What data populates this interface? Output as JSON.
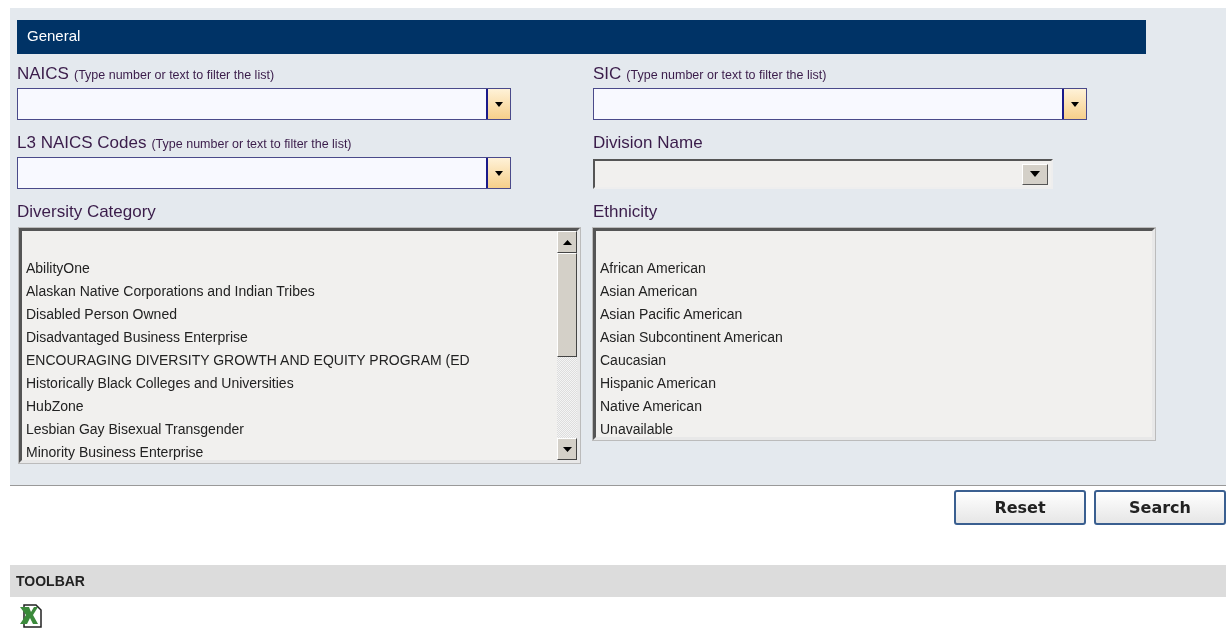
{
  "section": {
    "title": "General"
  },
  "fields": [
    {
      "kind": "combo",
      "label": "NAICS",
      "hint": "(Type number or text to filter the list)"
    },
    {
      "kind": "combo",
      "label": "SIC",
      "hint": "(Type number or text to filter the list)"
    },
    {
      "kind": "combo",
      "label": "L3 NAICS Codes",
      "hint": "(Type number or text to filter the list)"
    },
    {
      "kind": "select",
      "label": "Division Name"
    },
    {
      "kind": "list",
      "label": "Diversity Category",
      "scrollable": true,
      "items": [
        "AbilityOne",
        "Alaskan Native Corporations and Indian Tribes",
        "Disabled Person Owned",
        "Disadvantaged Business Enterprise",
        "ENCOURAGING DIVERSITY GROWTH AND EQUITY PROGRAM (ED",
        "Historically Black Colleges and Universities",
        "HubZone",
        "Lesbian Gay Bisexual Transgender",
        "Minority Business Enterprise"
      ]
    },
    {
      "kind": "list",
      "label": "Ethnicity",
      "scrollable": false,
      "items": [
        "African American",
        "Asian American",
        "Asian Pacific American",
        "Asian Subcontinent American",
        "Caucasian",
        "Hispanic American",
        "Native American",
        "Unavailable"
      ]
    }
  ],
  "buttons": [
    "Reset",
    "Search"
  ],
  "toolbar": {
    "title": "TOOLBAR"
  }
}
